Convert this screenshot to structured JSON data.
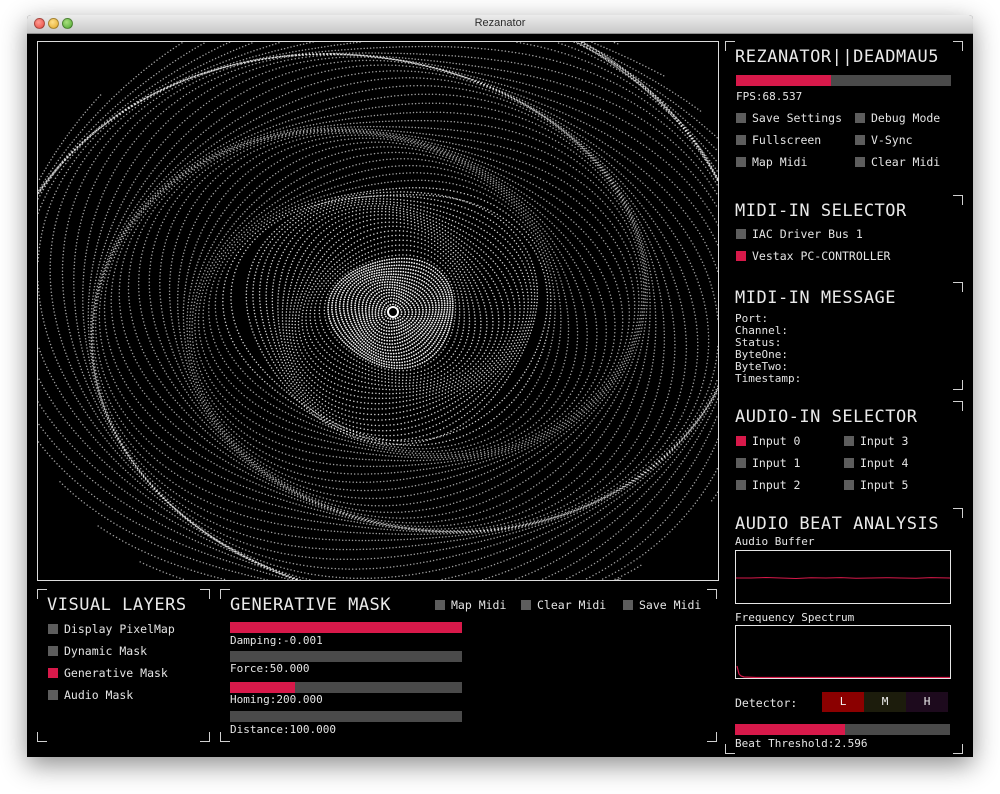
{
  "window": {
    "title": "Rezanator"
  },
  "app": {
    "title": "REZANATOR||DEADMAU5",
    "fps_label": "FPS:68.537",
    "fps_level": 0.44,
    "options": [
      {
        "label": "Save Settings",
        "on": false
      },
      {
        "label": "Debug Mode",
        "on": false
      },
      {
        "label": "Fullscreen",
        "on": false
      },
      {
        "label": "V-Sync",
        "on": false
      },
      {
        "label": "Map Midi",
        "on": false
      },
      {
        "label": "Clear Midi",
        "on": false
      }
    ]
  },
  "midi_selector": {
    "title": "MIDI-IN SELECTOR",
    "items": [
      {
        "label": "IAC Driver Bus 1",
        "on": false
      },
      {
        "label": "Vestax PC-CONTROLLER",
        "on": true
      }
    ]
  },
  "midi_message": {
    "title": "MIDI-IN MESSAGE",
    "fields": [
      "Port:",
      "Channel:",
      "Status:",
      "ByteOne:",
      "ByteTwo:",
      "Timestamp:"
    ]
  },
  "audio_selector": {
    "title": "AUDIO-IN SELECTOR",
    "inputs": [
      {
        "label": "Input 0",
        "on": true
      },
      {
        "label": "Input 3",
        "on": false
      },
      {
        "label": "Input 1",
        "on": false
      },
      {
        "label": "Input 4",
        "on": false
      },
      {
        "label": "Input 2",
        "on": false
      },
      {
        "label": "Input 5",
        "on": false
      }
    ]
  },
  "beat": {
    "title": "AUDIO BEAT ANALYSIS",
    "buffer_label": "Audio Buffer",
    "spectrum_label": "Frequency Spectrum",
    "detector_label": "Detector:",
    "detector": [
      {
        "label": "L",
        "bg": "#8b0000"
      },
      {
        "label": "M",
        "bg": "#1c1c0c"
      },
      {
        "label": "H",
        "bg": "#1d0a1d"
      }
    ],
    "threshold_label": "Beat Threshold:2.596",
    "threshold_level": 0.51
  },
  "layers": {
    "title": "VISUAL LAYERS",
    "items": [
      {
        "label": "Display PixelMap",
        "on": false
      },
      {
        "label": "Dynamic Mask",
        "on": false
      },
      {
        "label": "Generative Mask",
        "on": true
      },
      {
        "label": "Audio Mask",
        "on": false
      }
    ]
  },
  "mask": {
    "title": "GENERATIVE MASK",
    "buttons": [
      {
        "label": "Map Midi",
        "on": false
      },
      {
        "label": "Clear Midi",
        "on": false
      },
      {
        "label": "Save Midi",
        "on": false
      }
    ],
    "sliders": [
      {
        "label": "Damping:-0.001",
        "level": 1.0
      },
      {
        "label": "Force:50.000",
        "level": 0.0
      },
      {
        "label": "Homing:200.000",
        "level": 0.28
      },
      {
        "label": "Distance:100.000",
        "level": 0.0
      }
    ]
  },
  "colors": {
    "accent": "#d7194a",
    "background": "#000000",
    "toggle_off": "#5d5d5d",
    "bar_track": "#4a4a4a"
  }
}
